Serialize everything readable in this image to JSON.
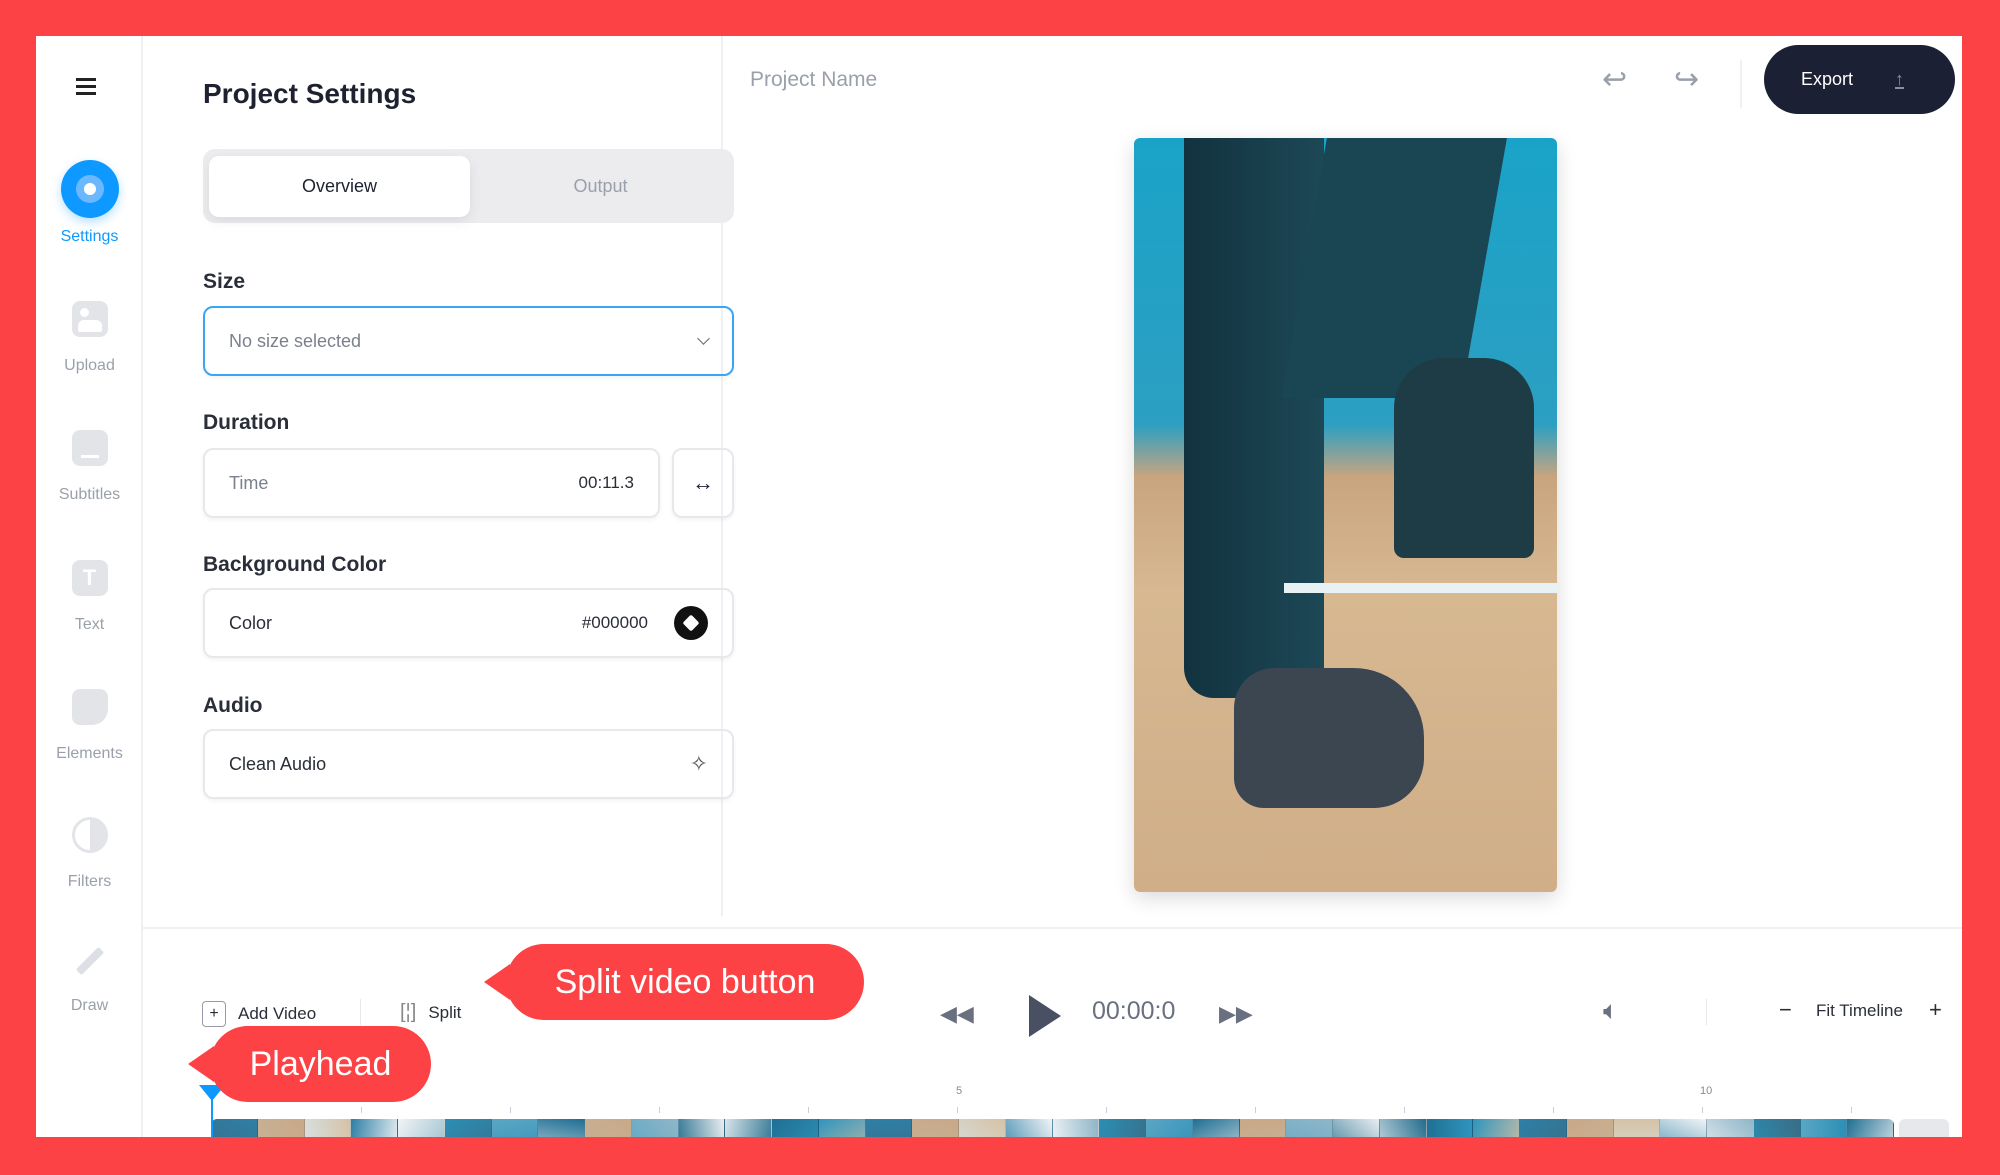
{
  "sidebar": {
    "items": [
      {
        "label": "Settings",
        "icon": "settings-icon",
        "active": true
      },
      {
        "label": "Upload",
        "icon": "image-icon"
      },
      {
        "label": "Subtitles",
        "icon": "subtitles-icon"
      },
      {
        "label": "Text",
        "icon": "text-icon"
      },
      {
        "label": "Elements",
        "icon": "sticker-icon"
      },
      {
        "label": "Filters",
        "icon": "filter-icon"
      },
      {
        "label": "Draw",
        "icon": "pencil-icon"
      }
    ]
  },
  "panel": {
    "title": "Project Settings",
    "tabs": [
      {
        "label": "Overview",
        "active": true
      },
      {
        "label": "Output"
      }
    ],
    "size": {
      "label": "Size",
      "placeholder": "No size selected"
    },
    "duration": {
      "label": "Duration",
      "field": "Time",
      "value": "00:11.3"
    },
    "background": {
      "label": "Background Color",
      "field": "Color",
      "value": "#000000"
    },
    "audio": {
      "label": "Audio",
      "field": "Clean Audio"
    }
  },
  "header": {
    "project_name": "Project Name",
    "export_label": "Export"
  },
  "toolbar": {
    "add_video": "Add Video",
    "split": "Split",
    "time": "00:00:0",
    "fit_timeline": "Fit Timeline"
  },
  "timeline": {
    "ticks": [
      "5",
      "10"
    ]
  },
  "annotations": {
    "split": "Split video button",
    "playhead": "Playhead"
  },
  "colors": {
    "accent": "#0d99ff",
    "export_bg": "#1b2034",
    "annotation": "#fc4245"
  }
}
